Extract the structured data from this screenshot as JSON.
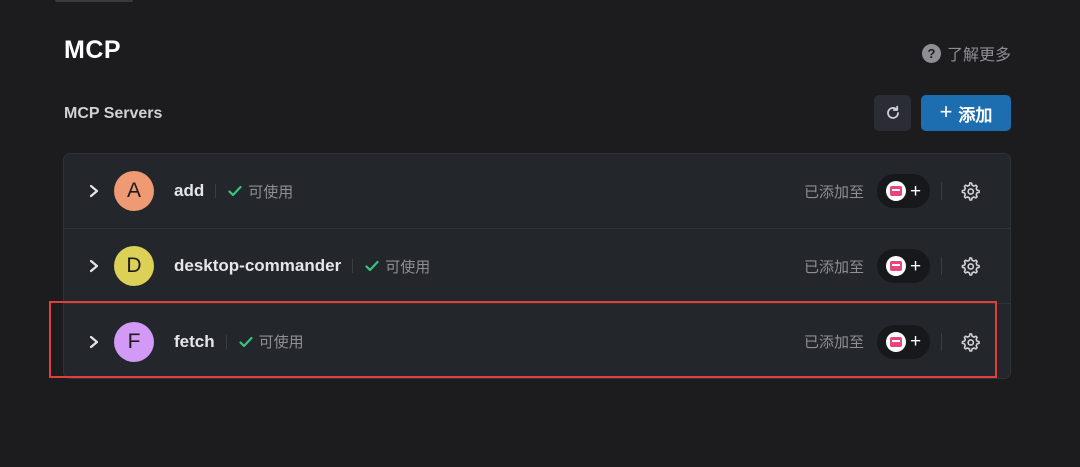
{
  "header": {
    "title": "MCP",
    "learn_more_label": "了解更多"
  },
  "section": {
    "title": "MCP Servers",
    "add_label": "添加"
  },
  "servers": [
    {
      "initial": "A",
      "name": "add",
      "status": "可使用",
      "added_to_label": "已添加至",
      "avatar_color": "#ef9a72"
    },
    {
      "initial": "D",
      "name": "desktop-commander",
      "status": "可使用",
      "added_to_label": "已添加至",
      "avatar_color": "#ddd056"
    },
    {
      "initial": "F",
      "name": "fetch",
      "status": "可使用",
      "added_to_label": "已添加至",
      "avatar_color": "#d299f6"
    }
  ],
  "colors": {
    "accent": "#1d6eb1",
    "status_ok": "#34c77b",
    "highlight": "#e0403c"
  },
  "icons": [
    "question-icon",
    "refresh-icon",
    "plus-icon",
    "chevron-right-icon",
    "check-icon",
    "client-app-icon",
    "gear-icon"
  ]
}
